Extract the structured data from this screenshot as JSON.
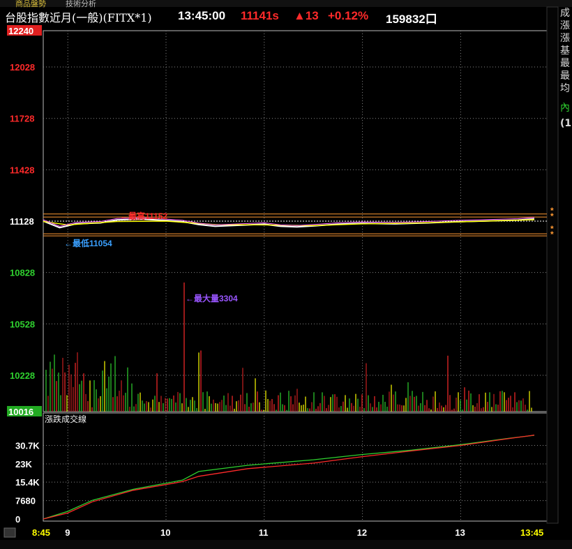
{
  "tabs": [
    "商品盤勢",
    "技術分析"
  ],
  "header": {
    "title": "台股指數近月(一般)(FITX*1)",
    "time": "13:45:00",
    "price": "11141s",
    "change": "▲13",
    "change_pct": "+0.12%",
    "volume": "159832口"
  },
  "side_labels": [
    "成",
    "漲",
    "漲",
    "基",
    "最",
    "最",
    "均",
    "內",
    "(1"
  ],
  "colors": {
    "up": "#ff2a2a",
    "down": "#2fd12f",
    "accent_yellow": "#ffff00",
    "ref_line": "#ff9933"
  },
  "chart_data": [
    {
      "type": "line",
      "panel": "price",
      "ylim": [
        10016,
        12240
      ],
      "y_ticks": [
        12240,
        12028,
        11728,
        11428,
        11128,
        10828,
        10528,
        10228,
        10016
      ],
      "x_ticks": [
        "8:45",
        "9",
        "10",
        "11",
        "12",
        "13",
        "13:45"
      ],
      "x_range": [
        "08:45",
        "13:45"
      ],
      "annotations": {
        "high_label": "←最高11152",
        "high": 11152,
        "low_label": "←最低11054",
        "low": 11054,
        "max_volume_label": "←最大量3304",
        "max_volume": 3304
      },
      "reference_line": 11128,
      "series": [
        {
          "color": "#ffffff",
          "points": [
            [
              "08:45",
              11128
            ],
            [
              "08:55",
              11090
            ],
            [
              "09:05",
              11112
            ],
            [
              "09:20",
              11118
            ],
            [
              "09:30",
              11135
            ],
            [
              "09:45",
              11140
            ],
            [
              "10:00",
              11132
            ],
            [
              "10:10",
              11125
            ],
            [
              "10:20",
              11108
            ],
            [
              "10:30",
              11098
            ],
            [
              "10:45",
              11104
            ],
            [
              "11:00",
              11110
            ],
            [
              "11:10",
              11098
            ],
            [
              "11:20",
              11094
            ],
            [
              "11:30",
              11100
            ],
            [
              "11:45",
              11110
            ],
            [
              "12:00",
              11115
            ],
            [
              "12:20",
              11112
            ],
            [
              "12:40",
              11118
            ],
            [
              "13:00",
              11125
            ],
            [
              "13:20",
              11130
            ],
            [
              "13:35",
              11134
            ],
            [
              "13:45",
              11141
            ]
          ]
        },
        {
          "color": "#ffff00",
          "points": [
            [
              "08:45",
              11126
            ],
            [
              "09:00",
              11106
            ],
            [
              "09:30",
              11126
            ],
            [
              "10:00",
              11128
            ],
            [
              "10:30",
              11108
            ],
            [
              "11:00",
              11106
            ],
            [
              "11:30",
              11102
            ],
            [
              "12:00",
              11112
            ],
            [
              "12:30",
              11116
            ],
            [
              "13:00",
              11124
            ],
            [
              "13:45",
              11136
            ]
          ]
        }
      ]
    },
    {
      "type": "bar",
      "panel": "volume",
      "description_values_max": 3304,
      "max_volume_time": "10:11"
    },
    {
      "type": "line",
      "panel": "cumulative",
      "title": "漲跌成交線",
      "ylim": [
        0,
        38400
      ],
      "y_ticks": [
        "30.7K",
        "23K",
        "15.4K",
        "7680",
        "0"
      ],
      "y_tick_values": [
        30700,
        23000,
        15400,
        7680,
        0
      ],
      "series": [
        {
          "color": "#2fd12f",
          "points": [
            [
              "08:45",
              0
            ],
            [
              "09:00",
              3200
            ],
            [
              "09:15",
              7800
            ],
            [
              "09:40",
              12400
            ],
            [
              "10:10",
              16200
            ],
            [
              "10:20",
              19800
            ],
            [
              "10:50",
              22400
            ],
            [
              "11:30",
              24700
            ],
            [
              "12:00",
              26900
            ],
            [
              "12:30",
              28700
            ],
            [
              "13:00",
              31000
            ],
            [
              "13:30",
              33700
            ],
            [
              "13:45",
              34900
            ]
          ]
        },
        {
          "color": "#ff2a2a",
          "points": [
            [
              "08:45",
              0
            ],
            [
              "09:00",
              2500
            ],
            [
              "09:15",
              7200
            ],
            [
              "09:40",
              12000
            ],
            [
              "10:10",
              15600
            ],
            [
              "10:20",
              17800
            ],
            [
              "10:50",
              21000
            ],
            [
              "11:30",
              23300
            ],
            [
              "12:00",
              26000
            ],
            [
              "12:30",
              28400
            ],
            [
              "13:00",
              30700
            ],
            [
              "13:30",
              33600
            ],
            [
              "13:45",
              35000
            ]
          ]
        }
      ]
    }
  ]
}
